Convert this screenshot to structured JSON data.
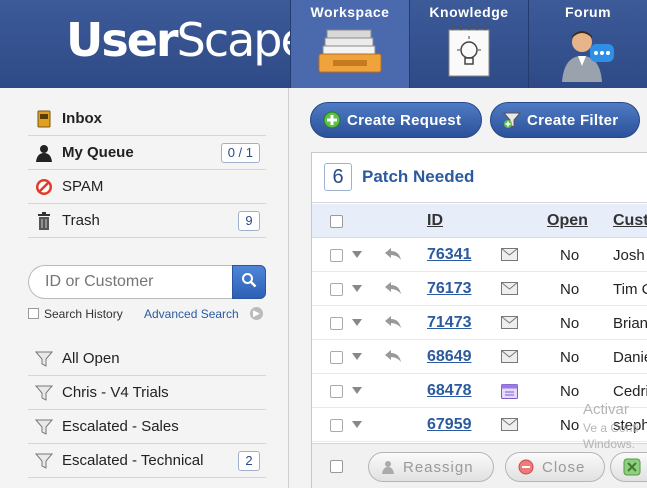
{
  "header": {
    "logo_text_a": "User",
    "logo_text_b": "Scape",
    "tabs": [
      {
        "label": "Workspace",
        "icon": "inbox-tray-icon",
        "active": true
      },
      {
        "label": "Knowledge",
        "icon": "lightbulb-notebook-icon",
        "active": false
      },
      {
        "label": "Forum",
        "icon": "user-chat-icon",
        "active": false
      }
    ]
  },
  "sidebar": {
    "items": [
      {
        "label": "Inbox",
        "icon": "inbox-icon",
        "bold": true,
        "count": ""
      },
      {
        "label": "My Queue",
        "icon": "person-icon",
        "bold": true,
        "count": "0 / 1"
      },
      {
        "label": "SPAM",
        "icon": "no-entry-icon",
        "bold": false,
        "count": ""
      },
      {
        "label": "Trash",
        "icon": "trash-icon",
        "bold": false,
        "count": "9"
      }
    ],
    "search": {
      "placeholder": "ID or Customer",
      "history_label": "Search History",
      "advanced_label": "Advanced Search"
    },
    "filters": [
      {
        "label": "All Open",
        "count": ""
      },
      {
        "label": "Chris - V4 Trials",
        "count": ""
      },
      {
        "label": "Escalated - Sales",
        "count": ""
      },
      {
        "label": "Escalated - Technical",
        "count": "2"
      }
    ]
  },
  "toolbar": {
    "create_request_label": "Create Request",
    "create_filter_label": "Create Filter"
  },
  "panel": {
    "count": "6",
    "title": "Patch Needed",
    "columns": {
      "id": "ID",
      "open": "Open",
      "customer": "Cust"
    },
    "rows": [
      {
        "id": "76341",
        "replied": true,
        "type": "mail",
        "open": "No",
        "customer": "Josh"
      },
      {
        "id": "76173",
        "replied": true,
        "type": "mail",
        "open": "No",
        "customer": "Tim C"
      },
      {
        "id": "71473",
        "replied": true,
        "type": "mail",
        "open": "No",
        "customer": "Brian"
      },
      {
        "id": "68649",
        "replied": true,
        "type": "mail",
        "open": "No",
        "customer": "Danie"
      },
      {
        "id": "68478",
        "replied": false,
        "type": "calendar",
        "open": "No",
        "customer": "Cedri"
      },
      {
        "id": "67959",
        "replied": false,
        "type": "mail",
        "open": "No",
        "customer": "steph"
      }
    ],
    "footer": {
      "reassign_label": "Reassign",
      "close_label": "Close"
    }
  },
  "watermark": {
    "line1": "Activar",
    "line2": "Ve a Confi",
    "line3": "Windows."
  }
}
